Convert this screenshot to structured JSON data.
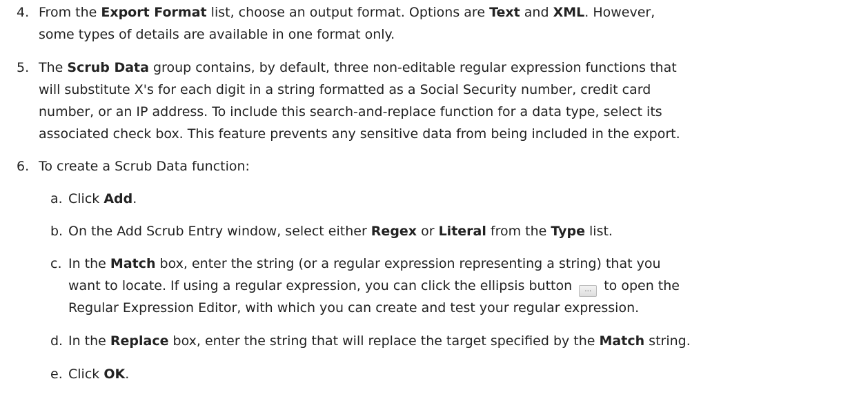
{
  "steps": [
    {
      "num": "4.",
      "lines": [
        [
          "From the ",
          {
            "b": "Export Format"
          },
          " list, choose an output format. Options are ",
          {
            "b": "Text"
          },
          " and ",
          {
            "b": "XML"
          },
          ". However,"
        ],
        [
          "some types of details are available in one format only."
        ]
      ]
    },
    {
      "num": "5.",
      "lines": [
        [
          "The ",
          {
            "b": "Scrub Data"
          },
          " group contains, by default, three non-editable regular expression functions that"
        ],
        [
          "will substitute X's for each digit in a string formatted as a Social Security number, credit card"
        ],
        [
          "number, or an IP address. To include this search-and-replace function for a data type, select its"
        ],
        [
          "associated check box. This feature prevents any sensitive data from being included in the export."
        ]
      ]
    },
    {
      "num": "6.",
      "lines": [
        [
          "To create a Scrub Data function:"
        ]
      ]
    }
  ],
  "substeps": [
    {
      "num": "a.",
      "lines": [
        [
          "Click ",
          {
            "b": "Add"
          },
          "."
        ]
      ]
    },
    {
      "num": "b.",
      "lines": [
        [
          "On the Add Scrub Entry window, select either ",
          {
            "b": "Regex"
          },
          " or ",
          {
            "b": "Literal"
          },
          " from the ",
          {
            "b": "Type"
          },
          " list."
        ]
      ]
    },
    {
      "num": "c.",
      "lines": [
        [
          "In the ",
          {
            "b": "Match"
          },
          " box, enter the string (or a regular expression representing a string) that you"
        ],
        [
          "want to locate. If using a regular expression, you can click the ellipsis button ",
          {
            "icon": "ellipsis-button-icon"
          },
          " to open the"
        ],
        [
          "Regular Expression Editor, with which you can create and test your regular expression."
        ]
      ]
    },
    {
      "num": "d.",
      "lines": [
        [
          "In the ",
          {
            "b": "Replace"
          },
          " box, enter the string that will replace the target specified by the ",
          {
            "b": "Match"
          },
          " string."
        ]
      ]
    },
    {
      "num": "e.",
      "lines": [
        [
          "Click ",
          {
            "b": "OK"
          },
          "."
        ]
      ]
    }
  ]
}
